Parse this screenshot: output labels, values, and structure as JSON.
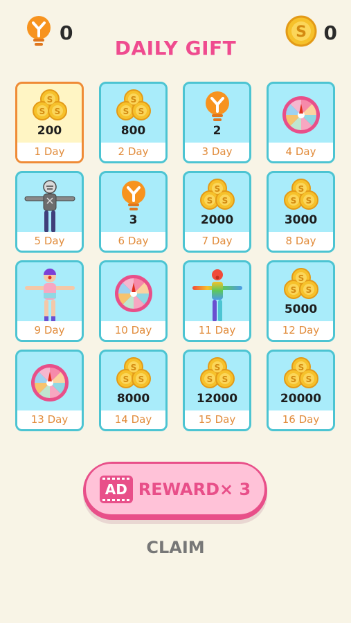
{
  "header": {
    "hints_count": "0",
    "coins_count": "0",
    "title": "DAILY GIFT"
  },
  "days": [
    {
      "day": "1 Day",
      "amount": "200",
      "reward": "coins",
      "active": true
    },
    {
      "day": "2 Day",
      "amount": "800",
      "reward": "coins"
    },
    {
      "day": "3 Day",
      "amount": "2",
      "reward": "hint"
    },
    {
      "day": "4 Day",
      "amount": "",
      "reward": "wheel"
    },
    {
      "day": "5 Day",
      "amount": "",
      "reward": "character-gray"
    },
    {
      "day": "6 Day",
      "amount": "3",
      "reward": "hint"
    },
    {
      "day": "7 Day",
      "amount": "2000",
      "reward": "coins"
    },
    {
      "day": "8 Day",
      "amount": "3000",
      "reward": "coins"
    },
    {
      "day": "9 Day",
      "amount": "",
      "reward": "character-girl"
    },
    {
      "day": "10 Day",
      "amount": "",
      "reward": "wheel"
    },
    {
      "day": "11 Day",
      "amount": "",
      "reward": "character-rainbow"
    },
    {
      "day": "12 Day",
      "amount": "5000",
      "reward": "coins"
    },
    {
      "day": "13 Day",
      "amount": "",
      "reward": "wheel"
    },
    {
      "day": "14 Day",
      "amount": "8000",
      "reward": "coins"
    },
    {
      "day": "15 Day",
      "amount": "12000",
      "reward": "coins"
    },
    {
      "day": "16 Day",
      "amount": "20000",
      "reward": "coins"
    }
  ],
  "actions": {
    "ad_badge": "AD",
    "reward_label": "REWARD× 3",
    "claim_label": "CLAIM"
  },
  "colors": {
    "title": "#ef4b8f",
    "card_bg": "#a9ecfa",
    "card_border": "#4cc4d2",
    "active_bg": "#fff5c4",
    "active_border": "#ef8b36",
    "day_text": "#e18b3a",
    "coin": "#f6c12b",
    "bulb": "#f7931e",
    "pink": "#e84f89"
  }
}
